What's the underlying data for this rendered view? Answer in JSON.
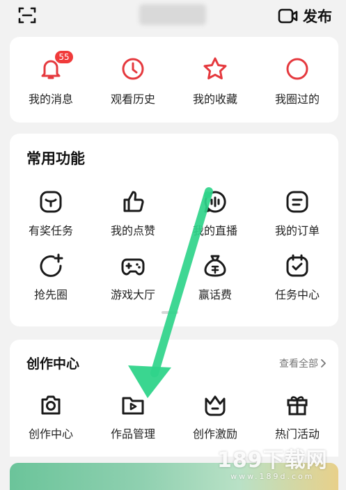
{
  "header": {
    "title_blurred": "",
    "publish_label": "发布",
    "scan_icon": "scan-icon",
    "video_icon": "video-camera-icon"
  },
  "quick_access": [
    {
      "label": "我的消息",
      "icon": "bell-icon",
      "badge": "55"
    },
    {
      "label": "观看历史",
      "icon": "clock-icon"
    },
    {
      "label": "我的收藏",
      "icon": "star-icon"
    },
    {
      "label": "我圈过的",
      "icon": "circle-icon"
    }
  ],
  "common": {
    "title": "常用功能",
    "items": [
      {
        "label": "有奖任务",
        "icon": "reward-task-icon"
      },
      {
        "label": "我的点赞",
        "icon": "thumbs-up-icon"
      },
      {
        "label": "我的直播",
        "icon": "live-icon"
      },
      {
        "label": "我的订单",
        "icon": "order-icon"
      },
      {
        "label": "抢先圈",
        "icon": "refresh-plus-icon"
      },
      {
        "label": "游戏大厅",
        "icon": "gamepad-icon"
      },
      {
        "label": "赢话费",
        "icon": "money-bag-icon"
      },
      {
        "label": "任务中心",
        "icon": "calendar-check-icon"
      }
    ]
  },
  "creation": {
    "title": "创作中心",
    "see_all": "查看全部",
    "items": [
      {
        "label": "创作中心",
        "icon": "camera-icon"
      },
      {
        "label": "作品管理",
        "icon": "folder-play-icon"
      },
      {
        "label": "创作激励",
        "icon": "crown-icon"
      },
      {
        "label": "热门活动",
        "icon": "gift-icon"
      }
    ]
  },
  "watermark": {
    "main": "189下载网",
    "sub": "www.189d.com"
  },
  "colors": {
    "accent_red": "#e5393e",
    "arrow_green": "#2fd48a",
    "icon_dark": "#1a1a1a"
  }
}
